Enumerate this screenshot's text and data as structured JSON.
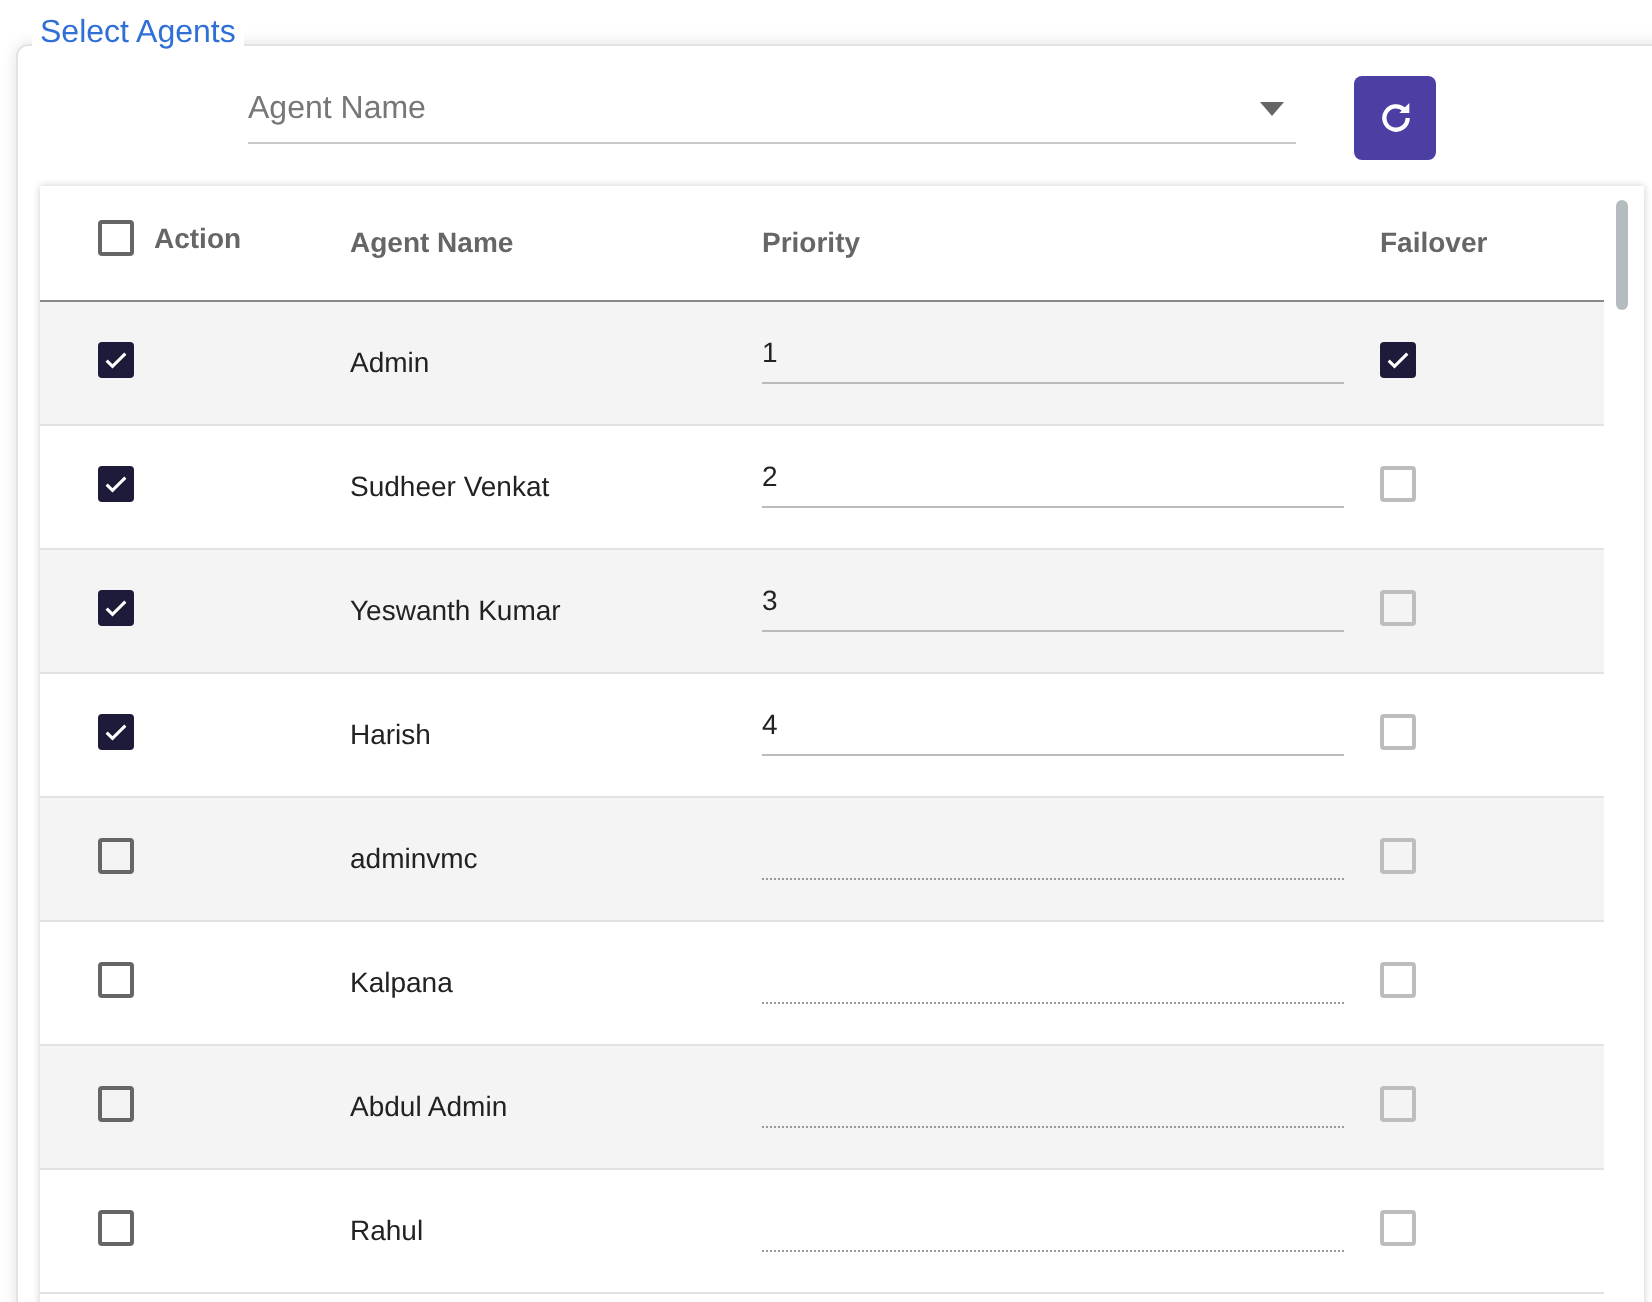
{
  "legend": "Select Agents",
  "agent_select": {
    "placeholder": "Agent Name"
  },
  "table": {
    "columns": [
      {
        "label": "Action",
        "select_all": {
          "checked": false
        }
      },
      {
        "label": "Agent Name"
      },
      {
        "label": "Priority"
      },
      {
        "label": "Failover"
      }
    ],
    "rows": [
      {
        "selected": true,
        "name": "Admin",
        "priority": "1",
        "failover": {
          "checked": true,
          "disabled": false
        }
      },
      {
        "selected": true,
        "name": "Sudheer Venkat",
        "priority": "2",
        "failover": {
          "checked": false,
          "disabled": true
        }
      },
      {
        "selected": true,
        "name": "Yeswanth Kumar",
        "priority": "3",
        "failover": {
          "checked": false,
          "disabled": true
        }
      },
      {
        "selected": true,
        "name": "Harish",
        "priority": "4",
        "failover": {
          "checked": false,
          "disabled": true
        }
      },
      {
        "selected": false,
        "name": "adminvmc",
        "failover": {
          "checked": false,
          "disabled": true
        }
      },
      {
        "selected": false,
        "name": "Kalpana",
        "failover": {
          "checked": false,
          "disabled": true
        }
      },
      {
        "selected": false,
        "name": "Abdul Admin",
        "failover": {
          "checked": false,
          "disabled": true
        }
      },
      {
        "selected": false,
        "name": "Rahul",
        "failover": {
          "checked": false,
          "disabled": true
        }
      }
    ]
  }
}
